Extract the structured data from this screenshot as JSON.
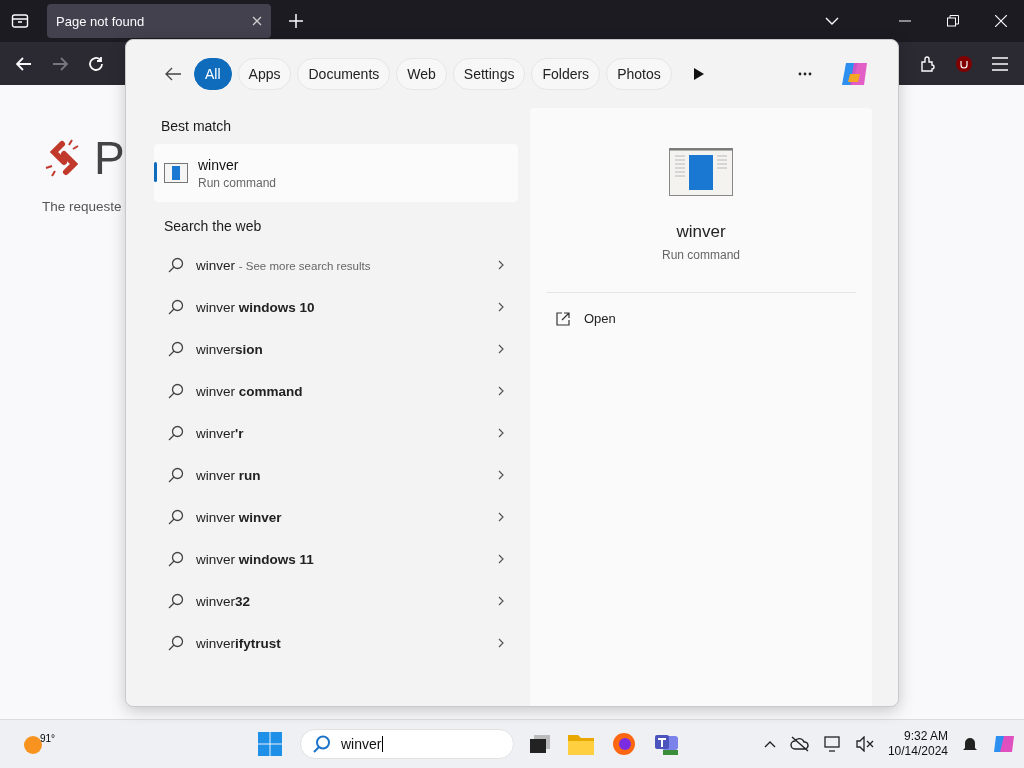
{
  "browser": {
    "tab": {
      "title": "Page not found"
    }
  },
  "page": {
    "heading": "P",
    "message": "The requeste"
  },
  "search_flyout": {
    "filters": [
      {
        "label": "All",
        "selected": true
      },
      {
        "label": "Apps",
        "selected": false
      },
      {
        "label": "Documents",
        "selected": false
      },
      {
        "label": "Web",
        "selected": false
      },
      {
        "label": "Settings",
        "selected": false
      },
      {
        "label": "Folders",
        "selected": false
      },
      {
        "label": "Photos",
        "selected": false
      }
    ],
    "best_match": {
      "heading": "Best match",
      "title": "winver",
      "subtitle": "Run command",
      "selected": true
    },
    "web": {
      "heading": "Search the web",
      "results": [
        {
          "kind": "more",
          "text": "winver",
          "hint": "- See more search results"
        },
        {
          "kind": "suggestion",
          "text": "winver **windows 10**"
        },
        {
          "kind": "suggestion",
          "text": "winver**sion**"
        },
        {
          "kind": "suggestion",
          "text": "winver **command**"
        },
        {
          "kind": "suggestion",
          "text": "winver**'r**"
        },
        {
          "kind": "suggestion",
          "text": "winver **run**"
        },
        {
          "kind": "suggestion",
          "text": "winver **winver**"
        },
        {
          "kind": "suggestion",
          "text": "winver **windows 11**"
        },
        {
          "kind": "suggestion",
          "text": "winver**32**"
        },
        {
          "kind": "suggestion",
          "text": "winver**ifytrust**"
        }
      ]
    },
    "detail": {
      "title": "winver",
      "subtitle": "Run command",
      "actions": [
        "Open"
      ]
    }
  },
  "taskbar": {
    "weather": "91°",
    "search": {
      "value": "winver"
    },
    "time": "9:32 AM",
    "date": "10/14/2024"
  }
}
